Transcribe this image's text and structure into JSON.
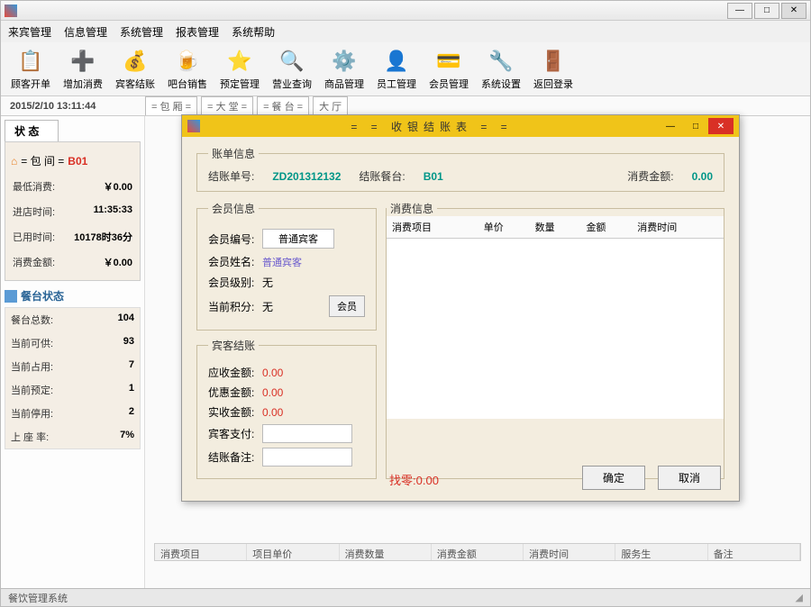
{
  "menubar": [
    "来宾管理",
    "信息管理",
    "系统管理",
    "报表管理",
    "系统帮助"
  ],
  "toolbar": [
    {
      "label": "顾客开单",
      "icon": "📋",
      "name": "new-order"
    },
    {
      "label": "增加消费",
      "icon": "➕",
      "name": "add-consume"
    },
    {
      "label": "宾客结账",
      "icon": "💰",
      "name": "checkout"
    },
    {
      "label": "吧台销售",
      "icon": "🍺",
      "name": "bar-sale"
    },
    {
      "label": "预定管理",
      "icon": "⭐",
      "name": "reservation"
    },
    {
      "label": "营业查询",
      "icon": "🔍",
      "name": "business-query"
    },
    {
      "label": "商品管理",
      "icon": "⚙️",
      "name": "goods-mgmt"
    },
    {
      "label": "员工管理",
      "icon": "👤",
      "name": "staff-mgmt"
    },
    {
      "label": "会员管理",
      "icon": "💳",
      "name": "member-mgmt"
    },
    {
      "label": "系统设置",
      "icon": "🔧",
      "name": "settings"
    },
    {
      "label": "返回登录",
      "icon": "🚪",
      "name": "logout"
    }
  ],
  "datetime": "2015/2/10 13:11:44",
  "tabs": [
    "= 包 厢 =",
    "= 大 堂 =",
    "= 餐 台 =",
    "大 厅"
  ],
  "sidebar": {
    "title": "状 态",
    "room": {
      "prefix": "= 包 间 =",
      "id": "B01"
    },
    "rows": [
      {
        "lbl": "最低消费:",
        "val": "￥0.00"
      },
      {
        "lbl": "进店时间:",
        "val": "11:35:33"
      },
      {
        "lbl": "已用时间:",
        "val": "10178时36分"
      },
      {
        "lbl": "消费金额:",
        "val": "￥0.00"
      }
    ],
    "stats_title": "餐台状态",
    "stats": [
      {
        "lbl": "餐台总数:",
        "val": "104"
      },
      {
        "lbl": "当前可供:",
        "val": "93"
      },
      {
        "lbl": "当前占用:",
        "val": "7"
      },
      {
        "lbl": "当前预定:",
        "val": "1"
      },
      {
        "lbl": "当前停用:",
        "val": "2"
      },
      {
        "lbl": "上 座 率:",
        "val": "7%"
      }
    ]
  },
  "bottom_cols": [
    "消费项目",
    "项目单价",
    "消费数量",
    "消费金额",
    "消费时间",
    "服务生",
    "备注"
  ],
  "statusbar": "餐饮管理系统",
  "modal": {
    "title": "= = 收银结账表 = =",
    "bill": {
      "legend": "账单信息",
      "num_lbl": "结账单号:",
      "num": "ZD201312132",
      "table_lbl": "结账餐台:",
      "table": "B01",
      "amt_lbl": "消费金额:",
      "amt": "0.00"
    },
    "member": {
      "legend": "会员信息",
      "num_lbl": "会员编号:",
      "num": "普通宾客",
      "name_lbl": "会员姓名:",
      "name": "普通宾客",
      "lvl_lbl": "会员级别:",
      "lvl": "无",
      "pts_lbl": "当前积分:",
      "pts": "无",
      "btn": "会员"
    },
    "consume": {
      "legend": "消费信息",
      "cols": [
        "消费项目",
        "单价",
        "数量",
        "金额",
        "消费时间"
      ]
    },
    "checkout": {
      "legend": "宾客结账",
      "due_lbl": "应收金额:",
      "due": "0.00",
      "disc_lbl": "优惠金额:",
      "disc": "0.00",
      "actual_lbl": "实收金额:",
      "actual": "0.00",
      "pay_lbl": "宾客支付:",
      "remark_lbl": "结账备注:"
    },
    "change_lbl": "找零:",
    "change": "0.00",
    "ok": "确定",
    "cancel": "取消"
  }
}
